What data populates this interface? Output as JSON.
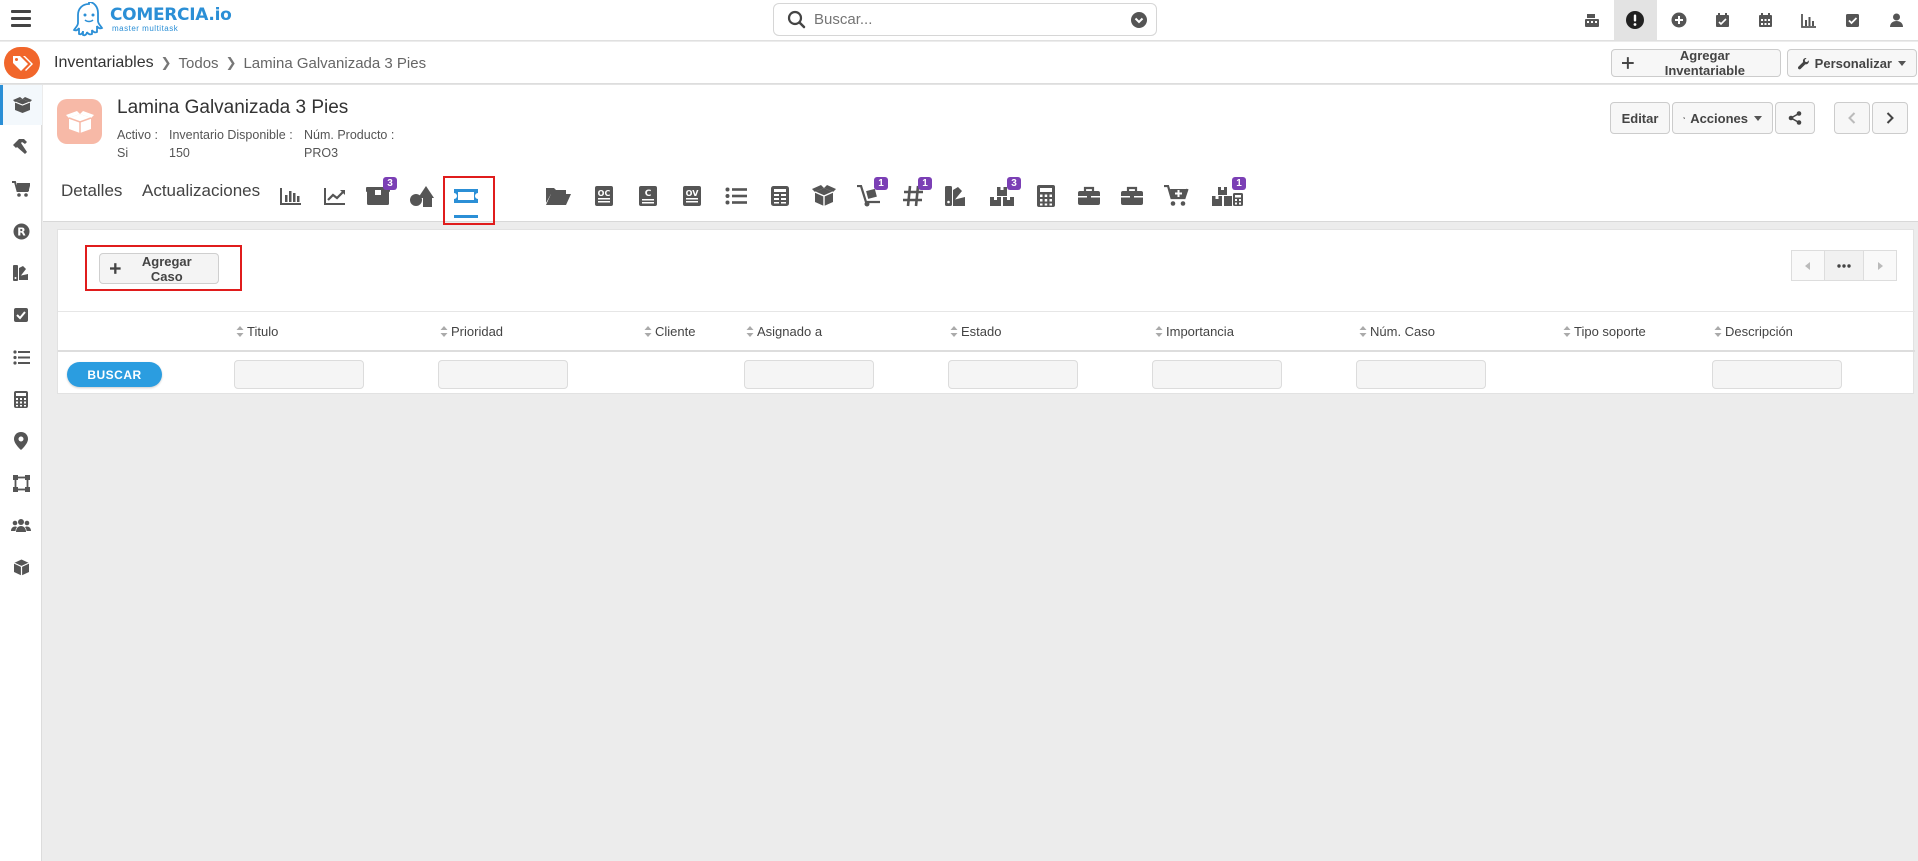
{
  "header": {
    "logo_name": "COMERCIA.io",
    "logo_tagline": "master multitask",
    "search_placeholder": "Buscar..."
  },
  "breadcrumb": {
    "items": [
      "Inventariables",
      "Todos",
      "Lamina Galvanizada 3 Pies"
    ]
  },
  "toolbar": {
    "add_inventariable_label": "Agregar Inventariable",
    "personalizar_label": "Personalizar"
  },
  "record": {
    "title": "Lamina Galvanizada 3 Pies",
    "fields": [
      {
        "label": "Activo :",
        "value": "Si"
      },
      {
        "label": "Inventario Disponible :",
        "value": "150"
      },
      {
        "label": "Núm. Producto :",
        "value": "PRO3"
      }
    ],
    "editar_label": "Editar",
    "acciones_label": "Acciones"
  },
  "tabs": {
    "detalles_label": "Detalles",
    "actualizaciones_label": "Actualizaciones",
    "badges": {
      "packages": "3",
      "dolly": "1",
      "hash": "1",
      "boxes": "3",
      "boxes_calc": "1"
    }
  },
  "cases": {
    "add_label": "Agregar Caso",
    "buscar_label": "BUSCAR",
    "columns": [
      "Titulo",
      "Prioridad",
      "Cliente",
      "Asignado a",
      "Estado",
      "Importancia",
      "Núm. Caso",
      "Tipo soporte",
      "Descripción"
    ]
  },
  "colors": {
    "brand_blue": "#2b8fd6",
    "module_orange": "#f1662b",
    "badge_purple": "#7b3fb5",
    "highlight_red": "#e01c1c"
  }
}
